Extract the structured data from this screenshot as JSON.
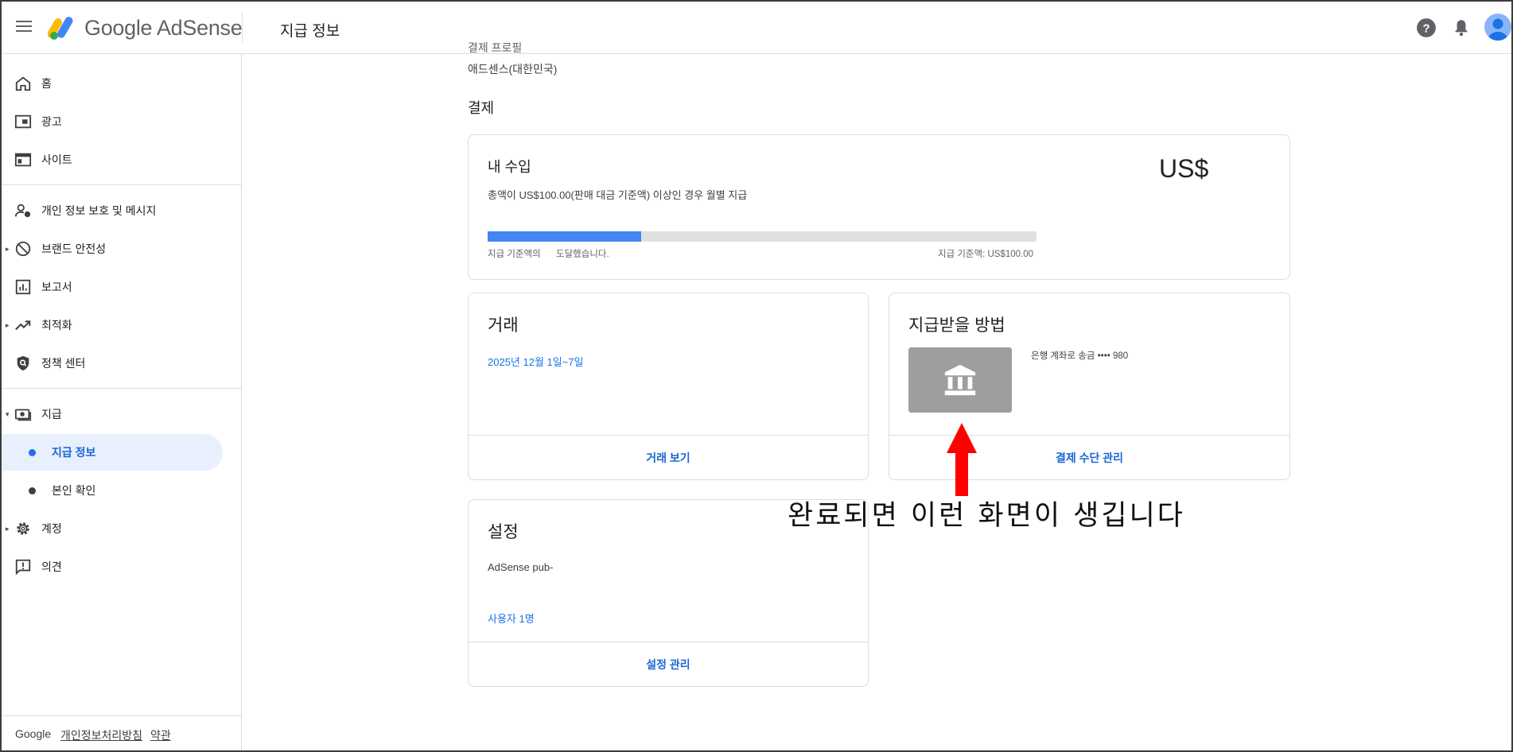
{
  "header": {
    "brand": "Google AdSense",
    "page_title": "지급 정보"
  },
  "sidebar": {
    "items": [
      {
        "label": "홈",
        "icon": "home-icon"
      },
      {
        "label": "광고",
        "icon": "ads-icon"
      },
      {
        "label": "사이트",
        "icon": "sites-icon"
      },
      {
        "label": "개인 정보 보호 및 메시지",
        "icon": "privacy-icon"
      },
      {
        "label": "브랜드 안전성",
        "icon": "block-icon"
      },
      {
        "label": "보고서",
        "icon": "reports-icon"
      },
      {
        "label": "최적화",
        "icon": "trending-icon"
      },
      {
        "label": "정책 센터",
        "icon": "policy-shield-icon"
      },
      {
        "label": "지급",
        "icon": "payments-icon"
      },
      {
        "label": "지급 정보",
        "icon": "dot"
      },
      {
        "label": "본인 확인",
        "icon": "dot"
      },
      {
        "label": "계정",
        "icon": "gear-icon"
      },
      {
        "label": "의견",
        "icon": "feedback-icon"
      }
    ],
    "footer": {
      "google": "Google",
      "privacy": "개인정보처리방침",
      "terms": "약관"
    }
  },
  "main": {
    "cut_text": "결제 프로필",
    "entity": "애드센스(대한민국)",
    "section": "결제",
    "earnings": {
      "title": "내 수입",
      "currency": "US$",
      "threshold_text": "총액이 US$100.00(판매 대금 기준액) 이상인 경우 월별 지급",
      "progress_fraction": 0.28,
      "left_label_a": "지급 기준액의",
      "left_label_b": "도달했습니다.",
      "right_label": "지급 기준액: US$100.00"
    },
    "transactions": {
      "title": "거래",
      "date_range": "2025년 12월 1일~7일",
      "footer": "거래 보기"
    },
    "payment_method": {
      "title": "지급받을 방법",
      "bank": "은행 계좌로 송금 •••• 980",
      "footer": "결제 수단 관리"
    },
    "settings": {
      "title": "설정",
      "pub_id": "AdSense pub-",
      "users": "사용자 1명",
      "footer": "설정 관리"
    }
  },
  "annotation": {
    "caption": "완료되면 이런 화면이 생깁니다",
    "arrow_color": "#ff0000"
  },
  "colors": {
    "accent": "#1a73e8",
    "active_bg": "#e8f0fe",
    "progress": "#4285f4"
  }
}
